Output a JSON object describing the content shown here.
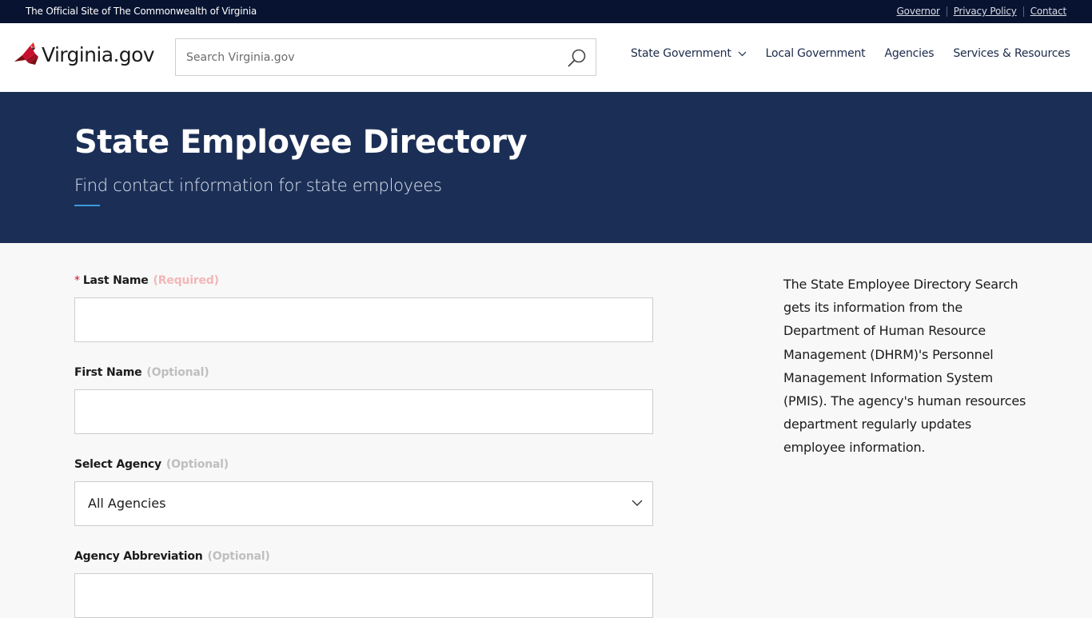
{
  "topbar": {
    "official_text": "The Official Site of The Commonwealth of Virginia",
    "links": [
      "Governor",
      "Privacy Policy",
      "Contact"
    ]
  },
  "header": {
    "logo_text": "Virginia.gov",
    "logo_icon": "cardinal-icon",
    "search_placeholder": "Search Virginia.gov",
    "search_icon": "search-icon",
    "nav": {
      "state_government": "State Government",
      "local_government": "Local Government",
      "agencies": "Agencies",
      "services": "Services & Resources"
    }
  },
  "hero": {
    "title": "State Employee Directory",
    "subtitle": "Find contact information for state employees"
  },
  "form": {
    "last_name": {
      "star": "*",
      "label": "Last Name",
      "hint": "(Required)",
      "value": ""
    },
    "first_name": {
      "label": "First Name",
      "hint": "(Optional)",
      "value": ""
    },
    "agency": {
      "label": "Select Agency",
      "hint": "(Optional)",
      "value": "All Agencies"
    },
    "abbreviation": {
      "label": "Agency Abbreviation",
      "hint": "(Optional)",
      "value": ""
    }
  },
  "info_text": "The State Employee Directory Search gets its information from the Department of Human Resource Management (DHRM)'s Personnel Management Information System (PMIS). The agency's human resources department regularly updates employee information.",
  "colors": {
    "topbar": "#071330",
    "hero": "#1b2f56",
    "accent": "#3a9bd9",
    "required": "#c8102e"
  }
}
